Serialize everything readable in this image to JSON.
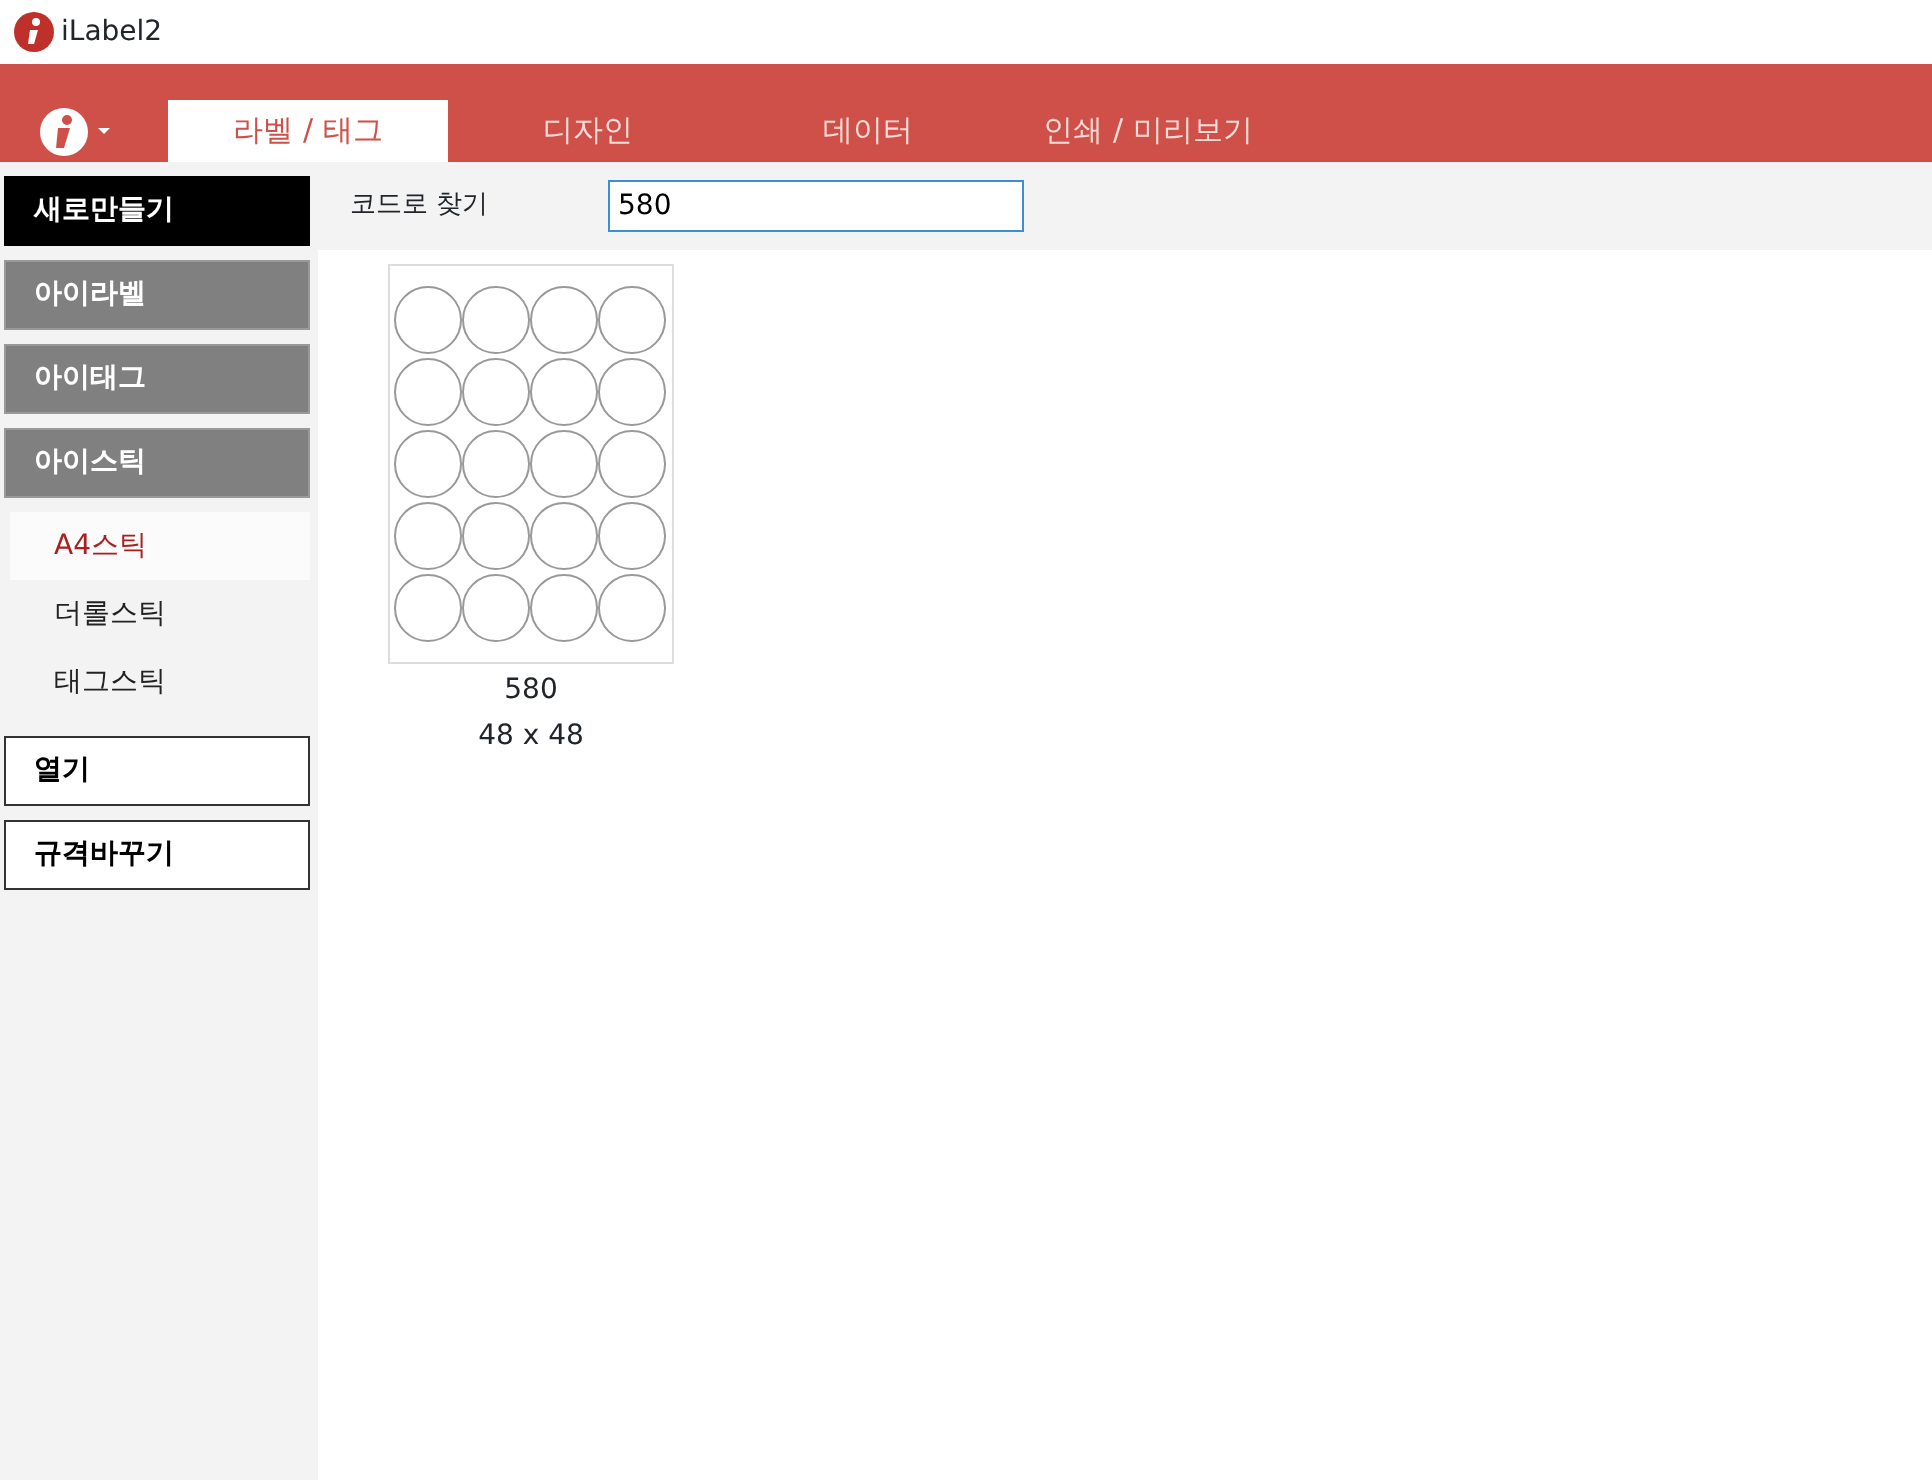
{
  "window": {
    "title": "iLabel2"
  },
  "tabs": [
    {
      "label": "라벨 / 태그",
      "selected": true
    },
    {
      "label": "디자인",
      "selected": false
    },
    {
      "label": "데이터",
      "selected": false
    },
    {
      "label": "인쇄 / 미리보기",
      "selected": false
    }
  ],
  "sidebar": {
    "items": [
      {
        "kind": "primary",
        "label": "새로만들기"
      },
      {
        "kind": "category",
        "label": "아이라벨"
      },
      {
        "kind": "category",
        "label": "아이태그"
      },
      {
        "kind": "category",
        "label": "아이스틱"
      },
      {
        "kind": "sub",
        "label": "A4스틱",
        "selected": true
      },
      {
        "kind": "sub",
        "label": "더롤스틱",
        "selected": false
      },
      {
        "kind": "sub",
        "label": "태그스틱",
        "selected": false
      },
      {
        "kind": "outline",
        "label": "열기"
      },
      {
        "kind": "outline",
        "label": "규격바꾸기"
      }
    ]
  },
  "search": {
    "label": "코드로 찾기",
    "value": "580"
  },
  "templates": [
    {
      "code": "580",
      "size": "48 x 48"
    }
  ]
}
